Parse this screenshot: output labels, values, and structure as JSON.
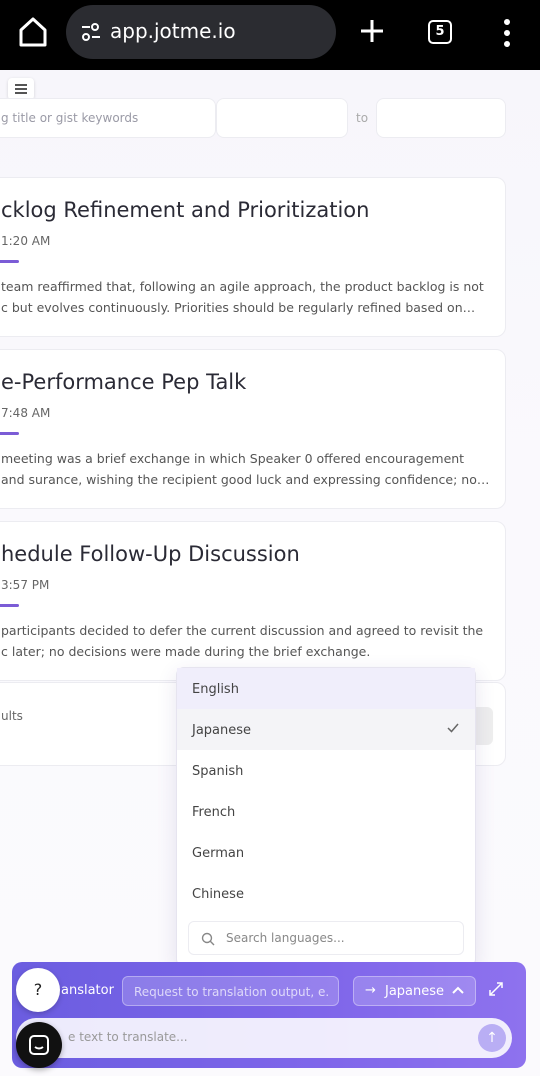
{
  "browser": {
    "url": "app.jotme.io",
    "tab_count": "5"
  },
  "filters": {
    "search_placeholder": "g title or gist keywords",
    "to_label": "to"
  },
  "meetings": [
    {
      "title": "cklog Refinement and Prioritization",
      "time": "1:20 AM",
      "summary": "team reaffirmed that, following an agile approach, the product backlog is not c but evolves continuously. Priorities should be regularly refined based on…"
    },
    {
      "title": "e-Performance Pep Talk",
      "time": "7:48 AM",
      "summary": "meeting was a brief exchange in which Speaker 0 offered encouragement and surance, wishing the recipient good luck and expressing confidence; no…"
    },
    {
      "title": "hedule Follow-Up Discussion",
      "time": "3:57 PM",
      "summary": "participants decided to defer the current discussion and agreed to revisit the c later; no decisions were made during the brief exchange."
    }
  ],
  "results_label": "ults",
  "language_dropdown": {
    "options": [
      "English",
      "Japanese",
      "Spanish",
      "French",
      "German",
      "Chinese"
    ],
    "highlighted": "English",
    "selected": "Japanese",
    "search_placeholder": "Search languages..."
  },
  "translator": {
    "help_glyph": "?",
    "label": "anslator",
    "request_placeholder": "Request to translation output, e.",
    "target_language": "Japanese",
    "input_placeholder": "e text to translate..."
  },
  "colors": {
    "accent": "#7b5cd6",
    "panel_start": "#6b5de0",
    "panel_end": "#8e72ee",
    "chrome_bg": "#000000"
  }
}
